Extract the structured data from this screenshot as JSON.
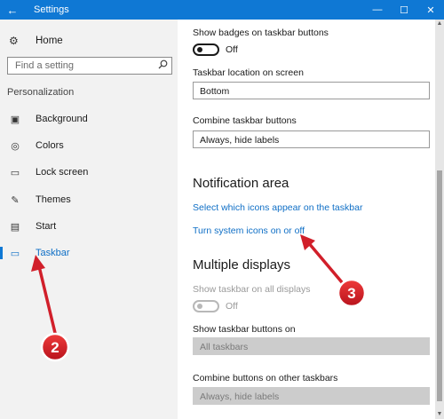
{
  "window": {
    "title": "Settings",
    "controls": {
      "minimize": "—",
      "maximize": "☐",
      "close": "✕"
    },
    "back_glyph": "←"
  },
  "sidebar": {
    "home": {
      "label": "Home",
      "icon": "gear-icon"
    },
    "search": {
      "placeholder": "Find a setting",
      "icon": "search-icon"
    },
    "section_label": "Personalization",
    "items": [
      {
        "label": "Background",
        "icon": "image-icon",
        "glyph": "▣"
      },
      {
        "label": "Colors",
        "icon": "palette-icon",
        "glyph": "◎"
      },
      {
        "label": "Lock screen",
        "icon": "lock-screen-icon",
        "glyph": "▭"
      },
      {
        "label": "Themes",
        "icon": "brush-icon",
        "glyph": "✎"
      },
      {
        "label": "Start",
        "icon": "start-icon",
        "glyph": "▤"
      },
      {
        "label": "Taskbar",
        "icon": "taskbar-icon",
        "glyph": "▭",
        "active": true
      }
    ],
    "accent": "#0f78d4"
  },
  "main": {
    "badges": {
      "label": "Show badges on taskbar buttons",
      "state": "Off"
    },
    "location": {
      "label": "Taskbar location on screen",
      "value": "Bottom"
    },
    "combine": {
      "label": "Combine taskbar buttons",
      "value": "Always, hide labels"
    },
    "notification": {
      "heading": "Notification area",
      "link_icons": "Select which icons appear on the taskbar",
      "link_system": "Turn system icons on or off"
    },
    "multiple": {
      "heading": "Multiple displays",
      "show_all": {
        "label": "Show taskbar on all displays",
        "state": "Off"
      },
      "buttons_on": {
        "label": "Show taskbar buttons on",
        "value": "All taskbars"
      },
      "combine_other": {
        "label": "Combine buttons on other taskbars",
        "value": "Always, hide labels"
      }
    }
  },
  "annotations": [
    {
      "number": "2",
      "color": "#d11f2a"
    },
    {
      "number": "3",
      "color": "#d11f2a"
    }
  ]
}
